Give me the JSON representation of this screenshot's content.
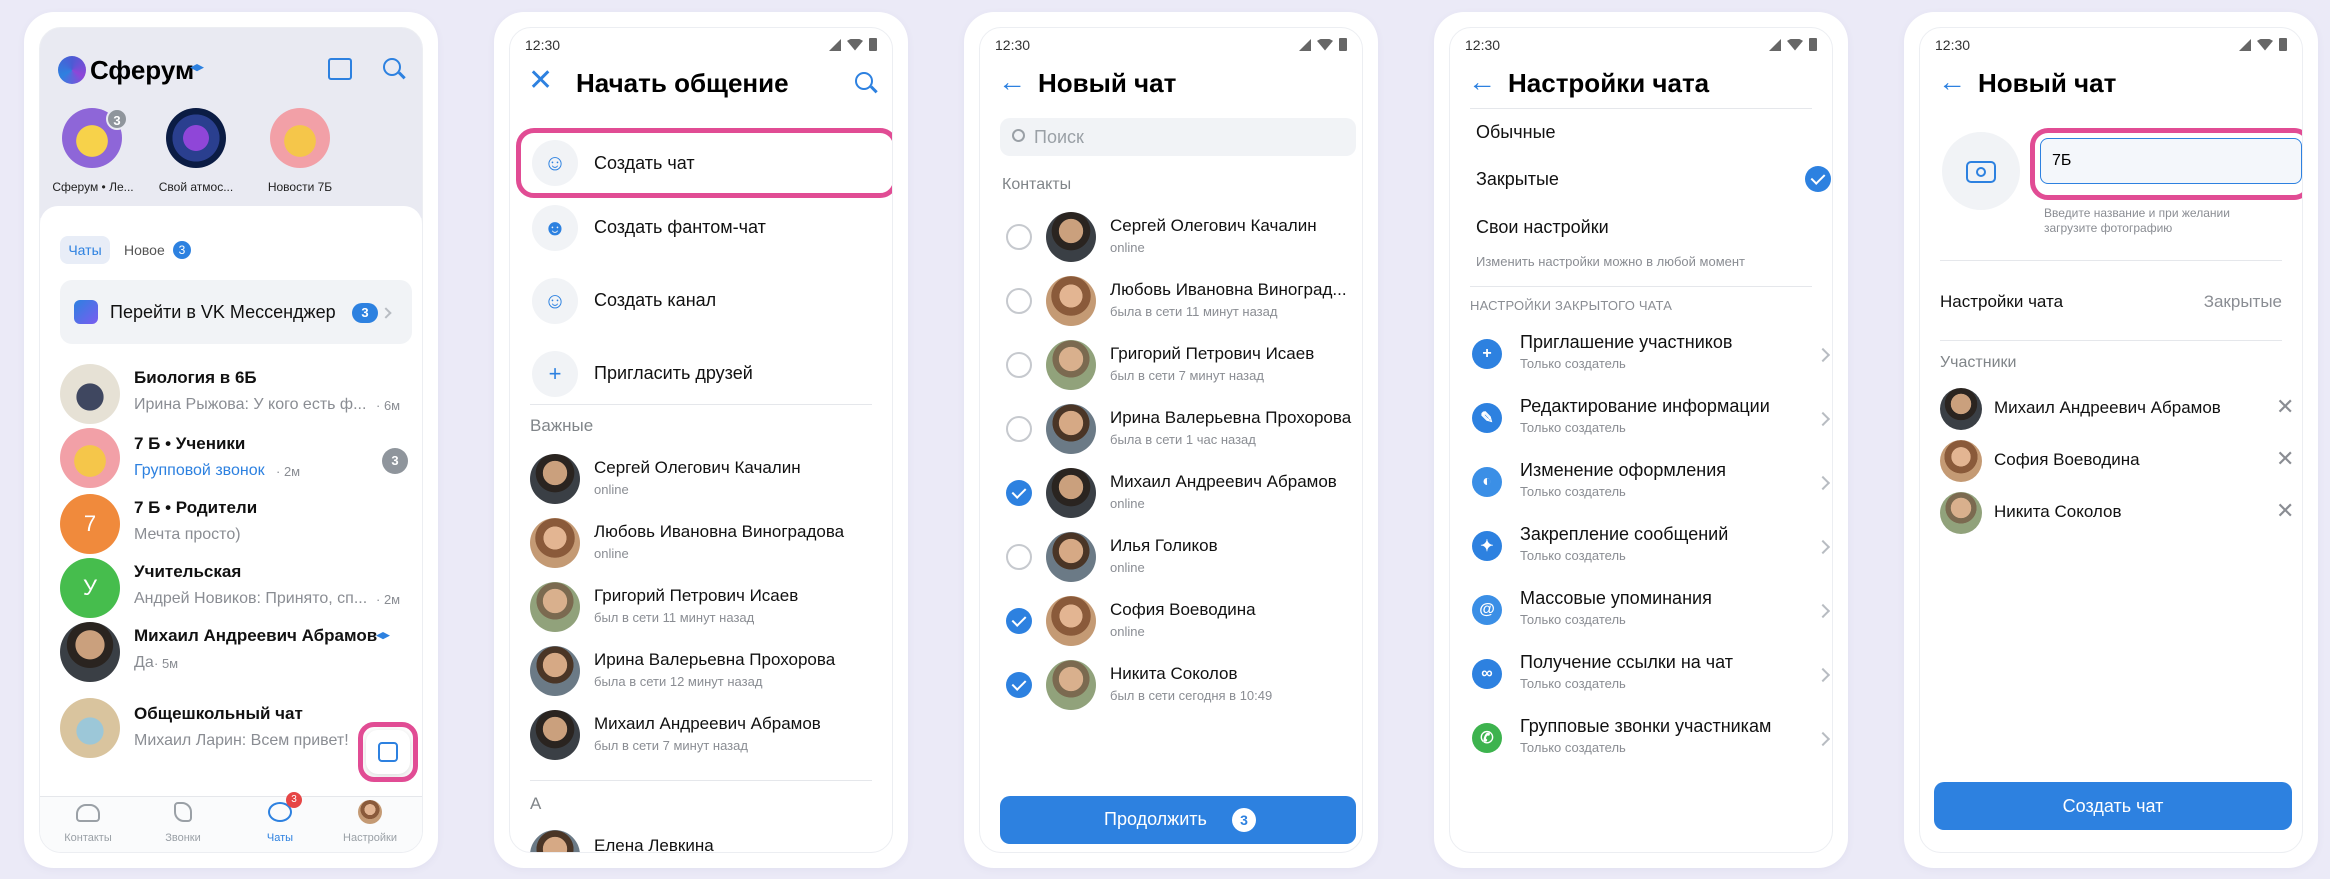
{
  "status_time": "12:30",
  "s1": {
    "brand": "Сферум",
    "stories": [
      {
        "label": "Сферум • Ле...",
        "count": "3"
      },
      {
        "label": "Свой атмос..."
      },
      {
        "label": "Новости 7Б"
      }
    ],
    "tabs": {
      "chats": "Чаты",
      "new": "Новое",
      "new_count": "3"
    },
    "vk_banner": {
      "text": "Перейти в VK Мессенджер",
      "count": "3"
    },
    "chats": [
      {
        "title": "Биология в 6Б",
        "preview": "Ирина Рыжова: У кого есть ф...",
        "time": "· 6м"
      },
      {
        "title": "7 Б • Ученики",
        "preview": "Групповой звонок",
        "time": "· 2м",
        "badge": "3"
      },
      {
        "title": "7 Б • Родители",
        "preview": "Мечта просто)",
        "avatar_text": "7"
      },
      {
        "title": "Учительская",
        "preview": "Андрей Новиков: Принято, сп...",
        "time": "· 2м",
        "avatar_text": "У"
      },
      {
        "title": "Михаил Андреевич Абрамов",
        "preview": "Да",
        "time": "· 5м"
      },
      {
        "title": "Общешкольный чат",
        "preview": "Михаил Ларин: Всем привет!"
      }
    ],
    "nav": [
      {
        "label": "Контакты"
      },
      {
        "label": "Звонки"
      },
      {
        "label": "Чаты",
        "badge": "3"
      },
      {
        "label": "Настройки"
      }
    ]
  },
  "s2": {
    "title": "Начать общение",
    "actions": [
      "Создать чат",
      "Создать фантом-чат",
      "Создать канал",
      "Пригласить друзей"
    ],
    "important_label": "Важные",
    "contacts": [
      {
        "name": "Сергей Олегович Качалин",
        "status": "online"
      },
      {
        "name": "Любовь Ивановна Виноградова",
        "status": "online"
      },
      {
        "name": "Григорий Петрович Исаев",
        "status": "был в сети 11 минут назад"
      },
      {
        "name": "Ирина Валерьевна Прохорова",
        "status": "была в сети 12 минут назад"
      },
      {
        "name": "Михаил Андреевич Абрамов",
        "status": "был в сети 7 минут назад"
      }
    ],
    "letter": "А",
    "letter_contact": "Елена Левкина"
  },
  "s3": {
    "title": "Новый чат",
    "search_placeholder": "Поиск",
    "section": "Контакты",
    "contacts": [
      {
        "name": "Сергей Олегович Качалин",
        "status": "online",
        "checked": false
      },
      {
        "name": "Любовь Ивановна Виноград...",
        "status": "была в сети 11 минут назад",
        "checked": false
      },
      {
        "name": "Григорий Петрович Исаев",
        "status": "был в сети 7 минут назад",
        "checked": false
      },
      {
        "name": "Ирина Валерьевна Прохорова",
        "status": "была в сети 1 час назад",
        "checked": false
      },
      {
        "name": "Михаил Андреевич Абрамов",
        "status": "online",
        "checked": true
      },
      {
        "name": "Илья Голиков",
        "status": "online",
        "checked": false
      },
      {
        "name": "София Воеводина",
        "status": "online",
        "checked": true
      },
      {
        "name": "Никита Соколов",
        "status": "был в сети сегодня в 10:49",
        "checked": true
      }
    ],
    "continue_label": "Продолжить",
    "continue_count": "3"
  },
  "s4": {
    "title": "Настройки чата",
    "options": [
      "Обычные",
      "Закрытые",
      "Свои настройки"
    ],
    "hint": "Изменить настройки можно в любой момент",
    "section": "НАСТРОЙКИ ЗАКРЫТОГО ЧАТА",
    "settings": [
      {
        "title": "Приглашение участников",
        "sub": "Только создатель",
        "icon": "+",
        "color": "#2d81e0"
      },
      {
        "title": "Редактирование информации",
        "sub": "Только создатель",
        "icon": "✎",
        "color": "#2d81e0"
      },
      {
        "title": "Изменение оформления",
        "sub": "Только создатель",
        "icon": "◐",
        "color": "#3b8fe6"
      },
      {
        "title": "Закрепление сообщений",
        "sub": "Только создатель",
        "icon": "✦",
        "color": "#2d81e0"
      },
      {
        "title": "Массовые упоминания",
        "sub": "Только создатель",
        "icon": "@",
        "color": "#3b8fe6"
      },
      {
        "title": "Получение ссылки на чат",
        "sub": "Только создатель",
        "icon": "∞",
        "color": "#2d81e0"
      },
      {
        "title": "Групповые звонки участникам",
        "sub": "Только создатель",
        "icon": "✆",
        "color": "#3db34e"
      }
    ]
  },
  "s5": {
    "title": "Новый чат",
    "name_value": "7Б",
    "name_hint": "Введите название и при желании загрузите фотографию",
    "settings_label": "Настройки чата",
    "settings_value": "Закрытые",
    "members_label": "Участники",
    "members": [
      "Михаил Андреевич Абрамов",
      "София Воеводина",
      "Никита Соколов"
    ],
    "create_label": "Создать чат"
  }
}
